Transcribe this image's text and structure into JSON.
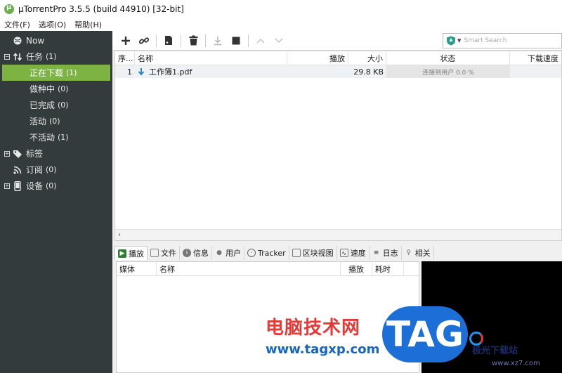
{
  "window": {
    "title": "µTorrentPro 3.5.5  (build 44910) [32-bit]"
  },
  "menu": [
    "文件(F)",
    "选项(O)",
    "帮助(H)"
  ],
  "sidebar": {
    "now": "Now",
    "tasks": {
      "label": "任务",
      "count": "(1)"
    },
    "task_items": [
      {
        "label": "正在下载",
        "count": "(1)"
      },
      {
        "label": "做种中",
        "count": "(0)"
      },
      {
        "label": "已完成",
        "count": "(0)"
      },
      {
        "label": "活动",
        "count": "(0)"
      },
      {
        "label": "不活动",
        "count": "(1)"
      }
    ],
    "labels": "标签",
    "feeds": {
      "label": "订阅",
      "count": "(0)"
    },
    "devices": {
      "label": "设备",
      "count": "(0)"
    }
  },
  "toolbar": {
    "search_placeholder": "Smart Search"
  },
  "torrent_list": {
    "columns": [
      "序...",
      "名称",
      "播放",
      "大小",
      "状态",
      "下载速度"
    ],
    "rows": [
      {
        "index": "1",
        "name": "工作簿1.pdf",
        "play": "",
        "size": "29.8 KB",
        "status": "连接到用户 0.0 %",
        "speed": ""
      }
    ]
  },
  "detail_tabs": [
    "播放",
    "文件",
    "信息",
    "用户",
    "Tracker",
    "区块视图",
    "速度",
    "日志",
    "相关"
  ],
  "detail_list": {
    "columns": [
      "媒体",
      "名称",
      "播放",
      "耗时"
    ]
  },
  "watermark": {
    "brand": "电脑技术网",
    "url": "www.tagxp.com",
    "tag": "TAG",
    "site": "极光下载站",
    "site_url": "www.xz7.com"
  }
}
